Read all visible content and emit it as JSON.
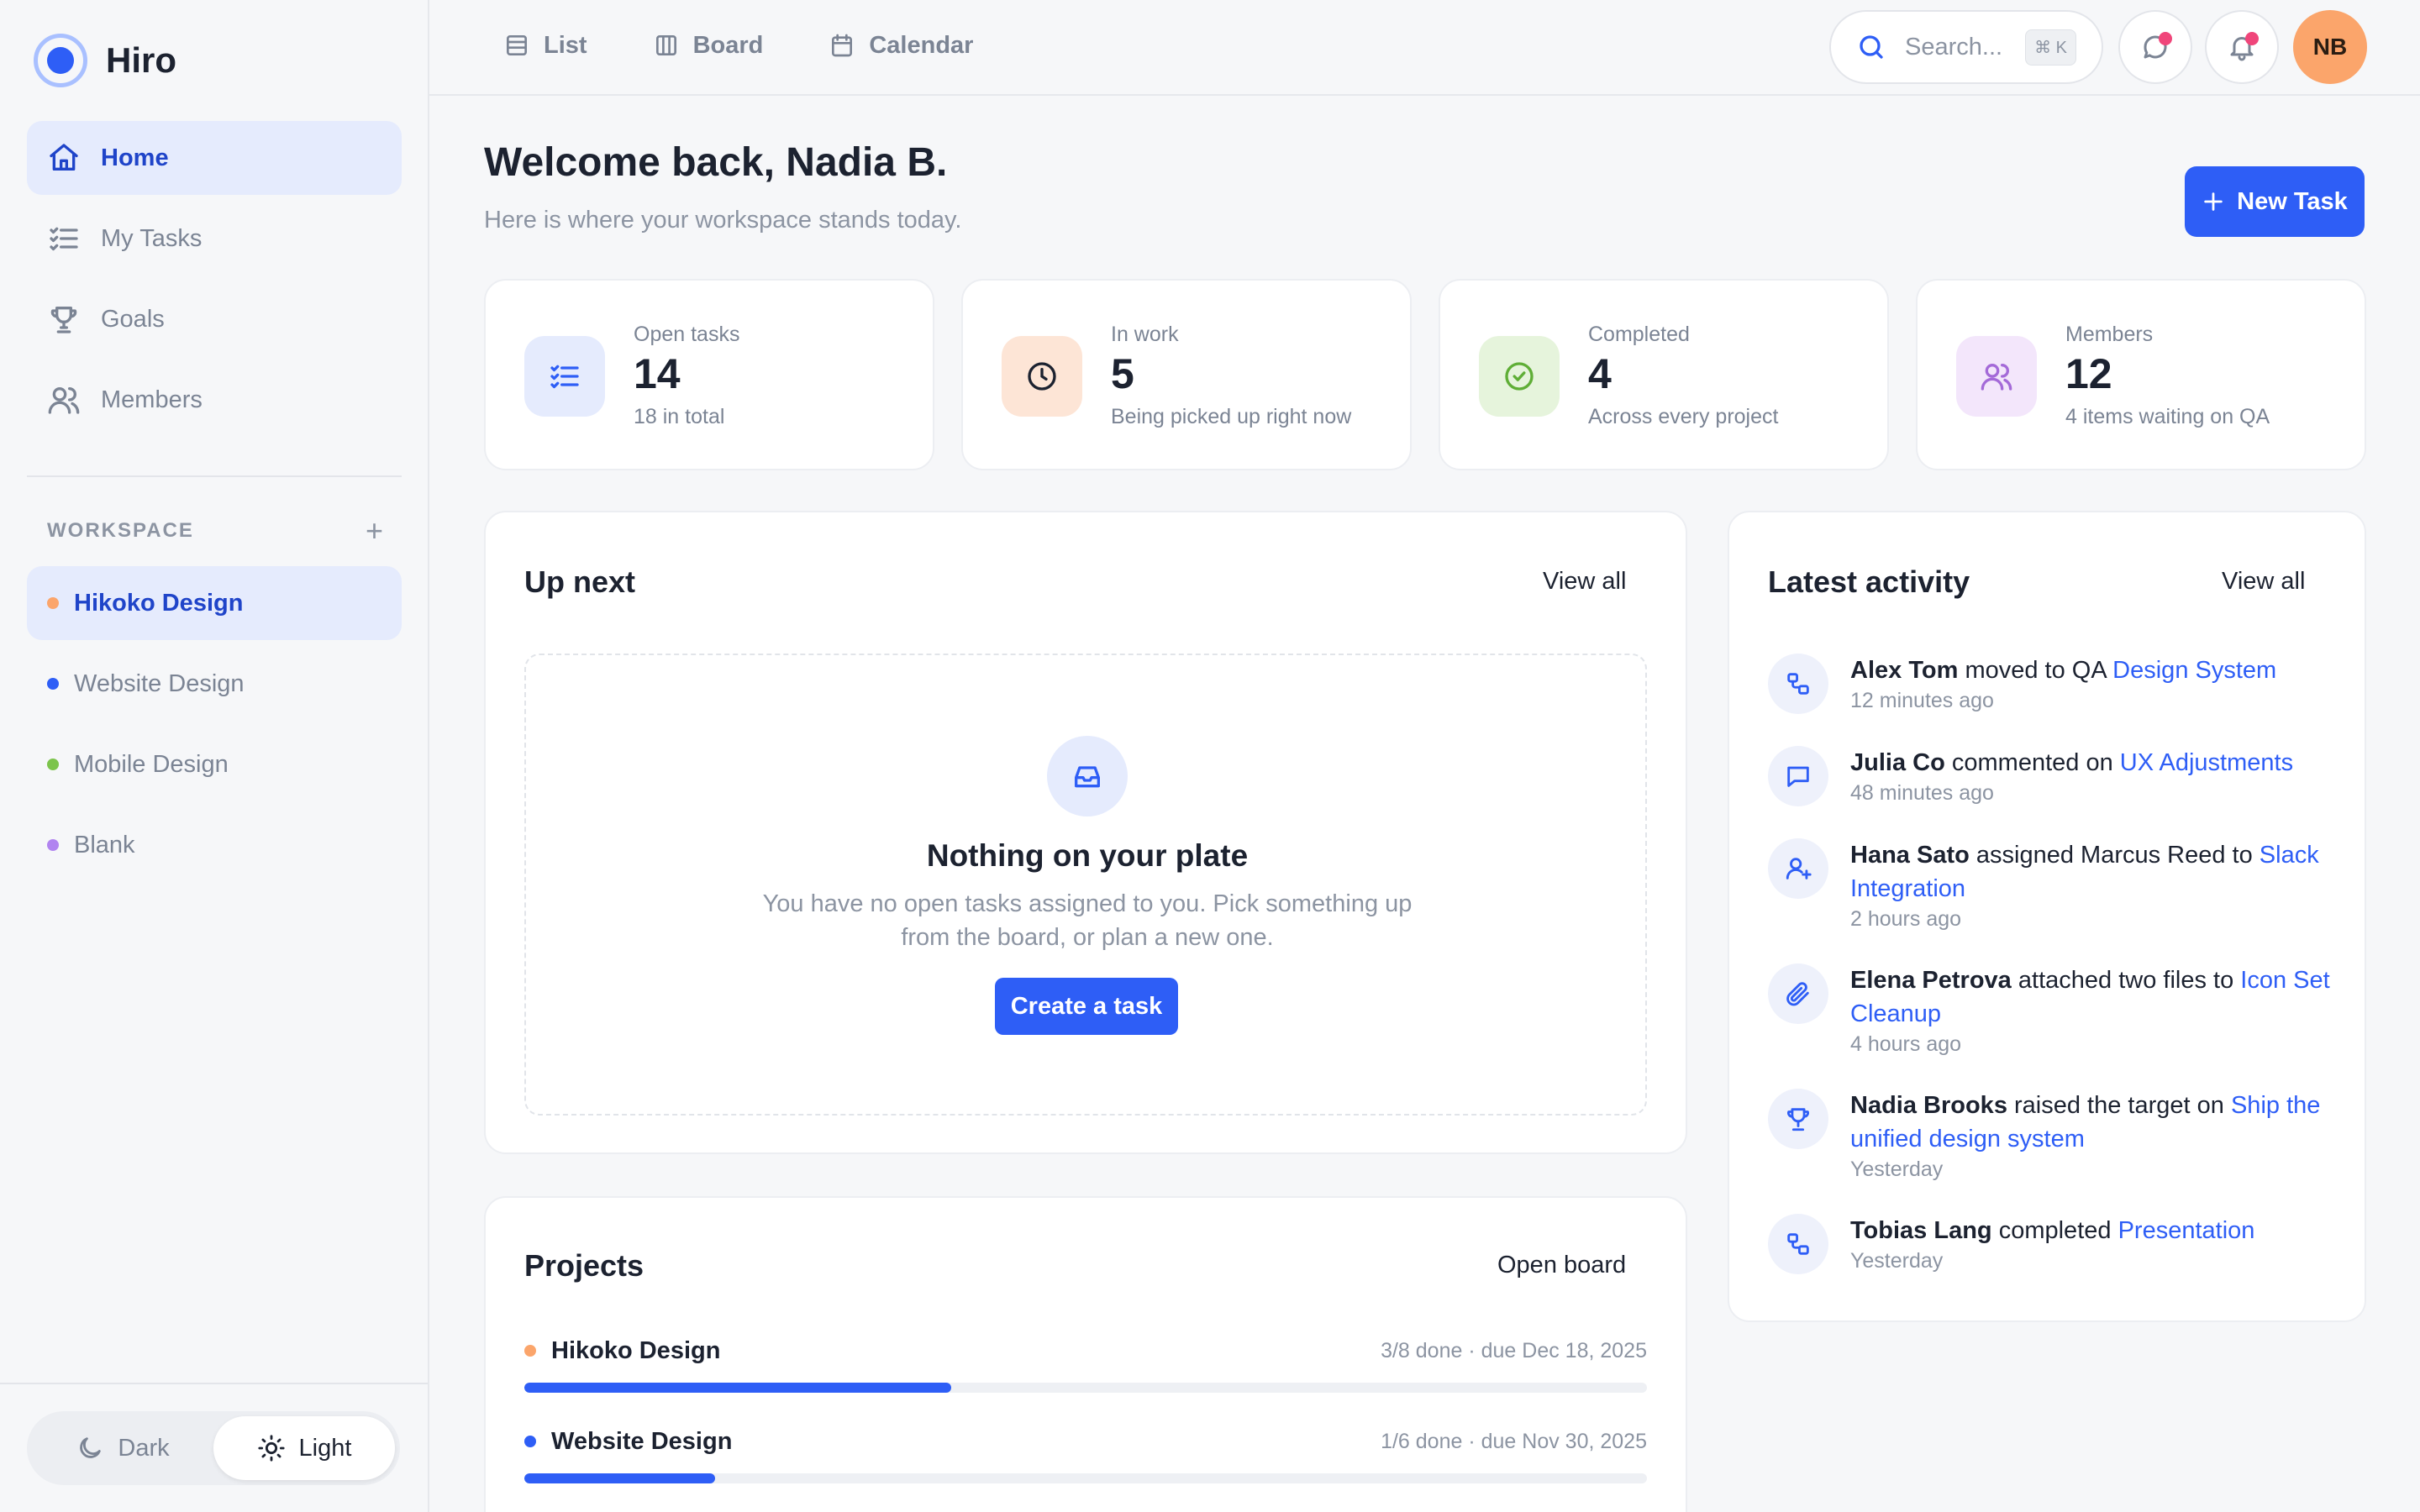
{
  "brand": {
    "name": "Hiro"
  },
  "nav": [
    {
      "label": "Home",
      "icon": "home-icon",
      "active": true
    },
    {
      "label": "My Tasks",
      "icon": "tasks-icon",
      "active": false
    },
    {
      "label": "Goals",
      "icon": "trophy-icon",
      "active": false
    },
    {
      "label": "Members",
      "icon": "members-icon",
      "active": false
    }
  ],
  "workspace": {
    "label": "WORKSPACE",
    "add": "+",
    "items": [
      {
        "label": "Hikoko Design",
        "color": "#fba56b",
        "active": true
      },
      {
        "label": "Website Design",
        "color": "#2e5ef6",
        "active": false
      },
      {
        "label": "Mobile Design",
        "color": "#7cc44c",
        "active": false
      },
      {
        "label": "Blank",
        "color": "#b184f0",
        "active": false
      }
    ]
  },
  "theme": {
    "dark": "Dark",
    "light": "Light",
    "selected": "Light"
  },
  "topbar": {
    "tabs": [
      {
        "label": "List",
        "icon": "list-icon"
      },
      {
        "label": "Board",
        "icon": "board-icon"
      },
      {
        "label": "Calendar",
        "icon": "calendar-icon"
      }
    ],
    "search_placeholder": "Search...",
    "search_shortcut": "⌘ K",
    "avatar_initials": "NB"
  },
  "header": {
    "title": "Welcome back, Nadia B.",
    "subtitle": "Here is where your workspace stands today.",
    "new_task": "New Task"
  },
  "stats": [
    {
      "label": "Open tasks",
      "value": "14",
      "sub": "18 in total",
      "icon": "tasks-icon",
      "bg": "#e5ebfd",
      "fg": "#2e5ef6"
    },
    {
      "label": "In work",
      "value": "5",
      "sub": "Being picked up right now",
      "icon": "clock-icon",
      "bg": "#fde5d6",
      "fg": "#1c2230"
    },
    {
      "label": "Completed",
      "value": "4",
      "sub": "Across every project",
      "icon": "check-circle-icon",
      "bg": "#e6f4dc",
      "fg": "#5fae36"
    },
    {
      "label": "Members",
      "value": "12",
      "sub": "4 items waiting on QA",
      "icon": "members-icon",
      "bg": "#f3e6fb",
      "fg": "#a46ad8"
    }
  ],
  "up_next": {
    "title": "Up next",
    "view_all": "View all",
    "empty_title": "Nothing on your plate",
    "empty_desc": "You have no open tasks assigned to you. Pick something up from the board, or plan a new one.",
    "create_label": "Create a task"
  },
  "projects": {
    "title": "Projects",
    "open_board": "Open board",
    "items": [
      {
        "name": "Hikoko Design",
        "meta": "3/8 done · due Dec 18, 2025",
        "progress": 0.38,
        "color": "#fba56b"
      },
      {
        "name": "Website Design",
        "meta": "1/6 done · due Nov 30, 2025",
        "progress": 0.17,
        "color": "#2e5ef6"
      }
    ]
  },
  "activity": {
    "title": "Latest activity",
    "view_all": "View all",
    "items": [
      {
        "actor": "Alex Tom",
        "action": "moved to QA",
        "target": "Design System",
        "time": "12 minutes ago",
        "icon": "flow-icon"
      },
      {
        "actor": "Julia Co",
        "action": "commented on",
        "target": "UX Adjustments",
        "time": "48 minutes ago",
        "icon": "comment-icon"
      },
      {
        "actor": "Hana Sato",
        "action": "assigned Marcus Reed to",
        "target": "Slack Integration",
        "time": "2 hours ago",
        "icon": "user-plus-icon"
      },
      {
        "actor": "Elena Petrova",
        "action": "attached two files to",
        "target": "Icon Set Cleanup",
        "time": "4 hours ago",
        "icon": "paperclip-icon"
      },
      {
        "actor": "Nadia Brooks",
        "action": "raised the target on",
        "target": "Ship the unified design system",
        "time": "Yesterday",
        "icon": "trophy-icon"
      },
      {
        "actor": "Tobias Lang",
        "action": "completed",
        "target": "Presentation",
        "time": "Yesterday",
        "icon": "flow-icon"
      }
    ]
  }
}
